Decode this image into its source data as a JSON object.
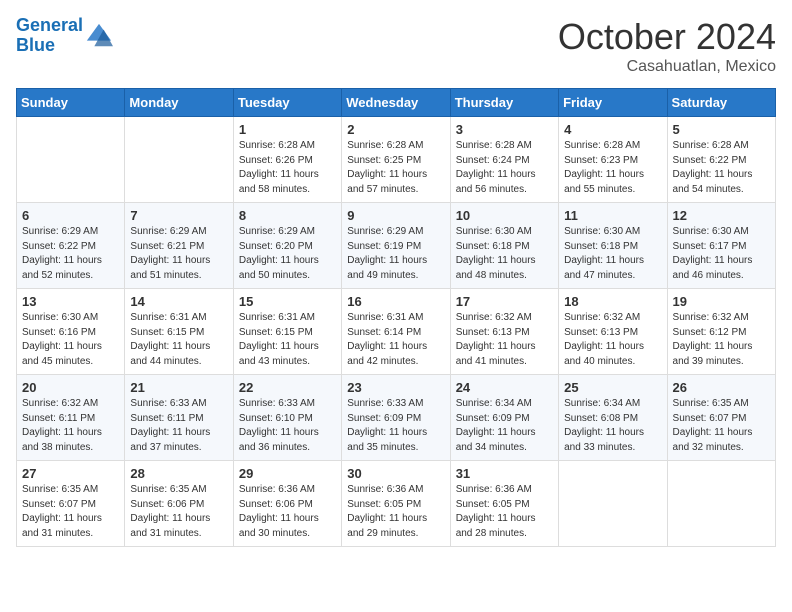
{
  "header": {
    "logo_line1": "General",
    "logo_line2": "Blue",
    "month": "October 2024",
    "location": "Casahuatlan, Mexico"
  },
  "days_of_week": [
    "Sunday",
    "Monday",
    "Tuesday",
    "Wednesday",
    "Thursday",
    "Friday",
    "Saturday"
  ],
  "weeks": [
    [
      {
        "day": "",
        "info": ""
      },
      {
        "day": "",
        "info": ""
      },
      {
        "day": "1",
        "info": "Sunrise: 6:28 AM\nSunset: 6:26 PM\nDaylight: 11 hours and 58 minutes."
      },
      {
        "day": "2",
        "info": "Sunrise: 6:28 AM\nSunset: 6:25 PM\nDaylight: 11 hours and 57 minutes."
      },
      {
        "day": "3",
        "info": "Sunrise: 6:28 AM\nSunset: 6:24 PM\nDaylight: 11 hours and 56 minutes."
      },
      {
        "day": "4",
        "info": "Sunrise: 6:28 AM\nSunset: 6:23 PM\nDaylight: 11 hours and 55 minutes."
      },
      {
        "day": "5",
        "info": "Sunrise: 6:28 AM\nSunset: 6:22 PM\nDaylight: 11 hours and 54 minutes."
      }
    ],
    [
      {
        "day": "6",
        "info": "Sunrise: 6:29 AM\nSunset: 6:22 PM\nDaylight: 11 hours and 52 minutes."
      },
      {
        "day": "7",
        "info": "Sunrise: 6:29 AM\nSunset: 6:21 PM\nDaylight: 11 hours and 51 minutes."
      },
      {
        "day": "8",
        "info": "Sunrise: 6:29 AM\nSunset: 6:20 PM\nDaylight: 11 hours and 50 minutes."
      },
      {
        "day": "9",
        "info": "Sunrise: 6:29 AM\nSunset: 6:19 PM\nDaylight: 11 hours and 49 minutes."
      },
      {
        "day": "10",
        "info": "Sunrise: 6:30 AM\nSunset: 6:18 PM\nDaylight: 11 hours and 48 minutes."
      },
      {
        "day": "11",
        "info": "Sunrise: 6:30 AM\nSunset: 6:18 PM\nDaylight: 11 hours and 47 minutes."
      },
      {
        "day": "12",
        "info": "Sunrise: 6:30 AM\nSunset: 6:17 PM\nDaylight: 11 hours and 46 minutes."
      }
    ],
    [
      {
        "day": "13",
        "info": "Sunrise: 6:30 AM\nSunset: 6:16 PM\nDaylight: 11 hours and 45 minutes."
      },
      {
        "day": "14",
        "info": "Sunrise: 6:31 AM\nSunset: 6:15 PM\nDaylight: 11 hours and 44 minutes."
      },
      {
        "day": "15",
        "info": "Sunrise: 6:31 AM\nSunset: 6:15 PM\nDaylight: 11 hours and 43 minutes."
      },
      {
        "day": "16",
        "info": "Sunrise: 6:31 AM\nSunset: 6:14 PM\nDaylight: 11 hours and 42 minutes."
      },
      {
        "day": "17",
        "info": "Sunrise: 6:32 AM\nSunset: 6:13 PM\nDaylight: 11 hours and 41 minutes."
      },
      {
        "day": "18",
        "info": "Sunrise: 6:32 AM\nSunset: 6:13 PM\nDaylight: 11 hours and 40 minutes."
      },
      {
        "day": "19",
        "info": "Sunrise: 6:32 AM\nSunset: 6:12 PM\nDaylight: 11 hours and 39 minutes."
      }
    ],
    [
      {
        "day": "20",
        "info": "Sunrise: 6:32 AM\nSunset: 6:11 PM\nDaylight: 11 hours and 38 minutes."
      },
      {
        "day": "21",
        "info": "Sunrise: 6:33 AM\nSunset: 6:11 PM\nDaylight: 11 hours and 37 minutes."
      },
      {
        "day": "22",
        "info": "Sunrise: 6:33 AM\nSunset: 6:10 PM\nDaylight: 11 hours and 36 minutes."
      },
      {
        "day": "23",
        "info": "Sunrise: 6:33 AM\nSunset: 6:09 PM\nDaylight: 11 hours and 35 minutes."
      },
      {
        "day": "24",
        "info": "Sunrise: 6:34 AM\nSunset: 6:09 PM\nDaylight: 11 hours and 34 minutes."
      },
      {
        "day": "25",
        "info": "Sunrise: 6:34 AM\nSunset: 6:08 PM\nDaylight: 11 hours and 33 minutes."
      },
      {
        "day": "26",
        "info": "Sunrise: 6:35 AM\nSunset: 6:07 PM\nDaylight: 11 hours and 32 minutes."
      }
    ],
    [
      {
        "day": "27",
        "info": "Sunrise: 6:35 AM\nSunset: 6:07 PM\nDaylight: 11 hours and 31 minutes."
      },
      {
        "day": "28",
        "info": "Sunrise: 6:35 AM\nSunset: 6:06 PM\nDaylight: 11 hours and 31 minutes."
      },
      {
        "day": "29",
        "info": "Sunrise: 6:36 AM\nSunset: 6:06 PM\nDaylight: 11 hours and 30 minutes."
      },
      {
        "day": "30",
        "info": "Sunrise: 6:36 AM\nSunset: 6:05 PM\nDaylight: 11 hours and 29 minutes."
      },
      {
        "day": "31",
        "info": "Sunrise: 6:36 AM\nSunset: 6:05 PM\nDaylight: 11 hours and 28 minutes."
      },
      {
        "day": "",
        "info": ""
      },
      {
        "day": "",
        "info": ""
      }
    ]
  ]
}
